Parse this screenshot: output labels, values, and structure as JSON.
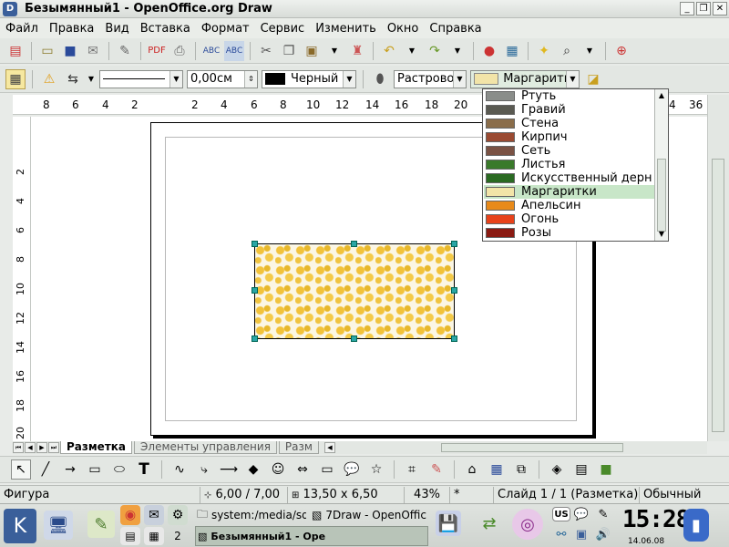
{
  "window": {
    "title": "Безымянный1 - OpenOffice.org Draw"
  },
  "menu": [
    "Файл",
    "Правка",
    "Вид",
    "Вставка",
    "Формат",
    "Сервис",
    "Изменить",
    "Окно",
    "Справка"
  ],
  "toolbar2": {
    "line_width": "0,00см",
    "line_color": "Черный",
    "area_style": "Растровое",
    "area_fill": "Маргаритки"
  },
  "ruler_h": [
    "8",
    "6",
    "4",
    "2",
    "2",
    "4",
    "6",
    "8",
    "10",
    "12",
    "14",
    "16",
    "18",
    "20",
    "4",
    "36"
  ],
  "ruler_v": [
    "2",
    "4",
    "6",
    "8",
    "10",
    "12",
    "14",
    "16",
    "18",
    "20"
  ],
  "dropdown": {
    "items": [
      {
        "label": "Ртуть",
        "color": "#8a8d8a"
      },
      {
        "label": "Гравий",
        "color": "#5a5a52"
      },
      {
        "label": "Стена",
        "color": "#8a6d4a"
      },
      {
        "label": "Кирпич",
        "color": "#9a4a32"
      },
      {
        "label": "Сеть",
        "color": "#7a5244"
      },
      {
        "label": "Листья",
        "color": "#3a7a2a"
      },
      {
        "label": "Искусственный дерн",
        "color": "#2a6a22"
      },
      {
        "label": "Маргаритки",
        "color": "#f2e4a8"
      },
      {
        "label": "Апельсин",
        "color": "#e88a1a"
      },
      {
        "label": "Огонь",
        "color": "#e8421a"
      },
      {
        "label": "Розы",
        "color": "#8a1a12"
      }
    ],
    "selected": "Маргаритки"
  },
  "tabs": [
    "Разметка",
    "Элементы управления",
    "Разм"
  ],
  "status": {
    "context": "Фигура",
    "position": "6,00 / 7,00",
    "size": "13,50 x 6,50",
    "zoom": "43%",
    "modified": "*",
    "slide": "Слайд 1 / 1 (Разметка)",
    "layout": "Обычный"
  },
  "taskbar": {
    "desktop_num": "2",
    "task1": "system:/media/sd",
    "task2": "7Draw - OpenOffic",
    "task3": "Безымянный1 - Оре",
    "kbd": "US",
    "clock": "15:28",
    "date": "14.06.08"
  }
}
